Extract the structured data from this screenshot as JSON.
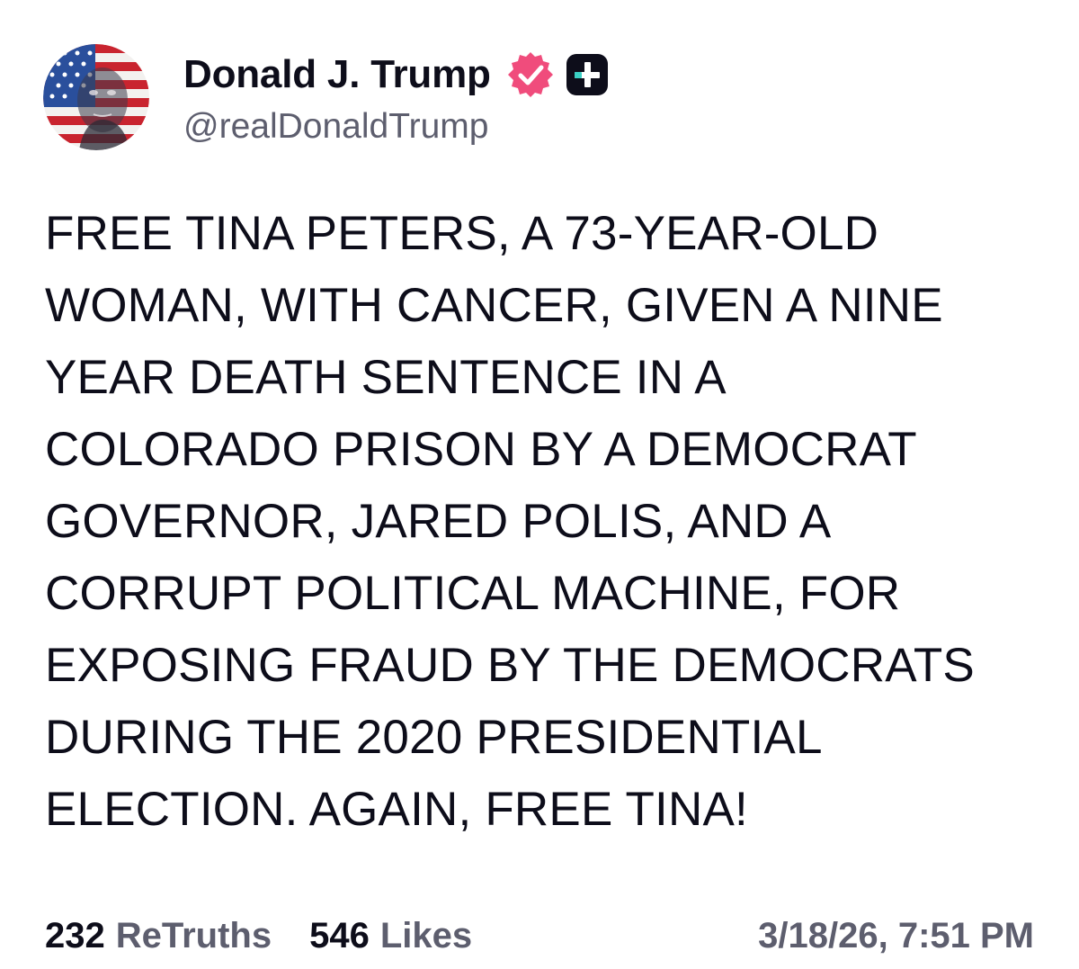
{
  "post": {
    "author": {
      "display_name": "Donald J. Trump",
      "handle": "@realDonaldTrump",
      "avatar_icon": "avatar-flag-portrait",
      "verified_icon": "verified-badge-icon",
      "plus_icon": "plus-badge-icon"
    },
    "body_lines": [
      "FREE TINA PETERS, A 73-YEAR-OLD",
      "WOMAN, WITH CANCER, GIVEN A NINE",
      "YEAR DEATH SENTENCE IN A",
      "COLORADO PRISON BY A DEMOCRAT",
      "GOVERNOR, JARED POLIS, AND A",
      "CORRUPT POLITICAL MACHINE, FOR",
      "EXPOSING FRAUD BY THE DEMOCRATS",
      "DURING THE 2020 PRESIDENTIAL",
      "ELECTION. AGAIN, FREE TINA!"
    ],
    "stats": {
      "retruths_count": "232",
      "retruths_label": "ReTruths",
      "likes_count": "546",
      "likes_label": "Likes"
    },
    "timestamp": "3/18/26, 7:51 PM"
  },
  "colors": {
    "text_primary": "#0d0d1a",
    "text_secondary": "#5d5e6e",
    "verified_pink": "#f04c7c",
    "plus_bg": "#0d0d1a",
    "plus_accent": "#3ad0c4"
  }
}
